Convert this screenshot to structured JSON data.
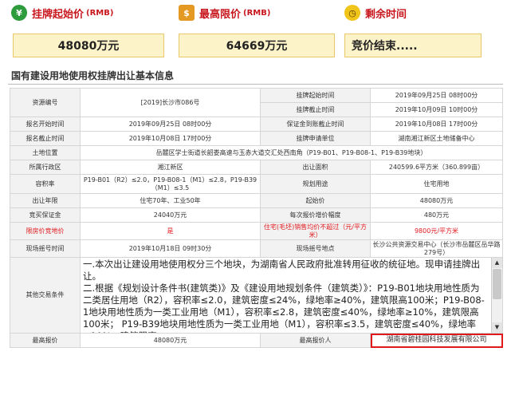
{
  "header": {
    "start_price_label": "挂牌起始价",
    "max_price_label": "最高限价",
    "remaining_label": "剩余时间",
    "unit_rmb": "(RMB)",
    "start_price_value": "48080万元",
    "max_price_value": "64669万元",
    "remaining_value": "竞价结束....."
  },
  "section_title": "国有建设用地使用权挂牌出让基本信息",
  "table": {
    "resource_no_label": "资源编号",
    "resource_no_value": "[2019]长沙市086号",
    "listing_start_time_label": "挂牌起始时间",
    "listing_start_time_value": "2019年09月25日 08时00分",
    "listing_end_time_label": "挂牌截止时间",
    "listing_end_time_value": "2019年10月09日 10时00分",
    "reg_start_label": "报名开始时间",
    "reg_start_value": "2019年09月25日 08时00分",
    "deposit_deadline_label": "保证金到账截止时间",
    "deposit_deadline_value": "2019年10月08日 17时00分",
    "reg_end_label": "报名截止时间",
    "reg_end_value": "2019年10月08日 17时00分",
    "applicant_label": "挂牌申请单位",
    "applicant_value": "湖南湘江新区土地储备中心",
    "location_label": "土地位置",
    "location_value": "岳麓区学士街道长韶娄高速与玉赤大道交汇处西南角（P19-B01、P19-B08-1、P19-B39地块）",
    "district_label": "所属行政区",
    "district_value": "湘江新区",
    "area_label": "出让面积",
    "area_value": "240599.6平方米（360.899亩）",
    "far_label": "容积率",
    "far_value": "P19-B01（R2）≤2.0，P19-B08-1（M1）≤2.8，P19-B39（M1）≤3.5",
    "use_label": "规划用途",
    "use_value": "住宅用地",
    "term_label": "出让年限",
    "term_value": "住宅70年、工业50年",
    "start_price_label": "起始价",
    "start_price_value": "48080万元",
    "bond_label": "竞买保证金",
    "bond_value": "24040万元",
    "increment_label": "每次报价增价幅度",
    "increment_value": "480万元",
    "limited_label": "限房价竞地价",
    "limited_value": "是",
    "house_price_label": "住宅(毛坯)销售均价不超过（元/平方米）",
    "house_price_value": "9800元/平方米",
    "draw_time_label": "现场摇号时间",
    "draw_time_value": "2019年10月18日 09时30分",
    "draw_place_label": "现场摇号地点",
    "draw_place_value": "长沙公共资源交易中心（长沙市岳麓区岳华路279号）",
    "other_label": "其他交易条件",
    "other_value": "一.本次出让建设用地使用权分三个地块，为湖南省人民政府批准转用征收的统征地。现申请挂牌出让。\n二.根据《规划设计条件书(建筑类)》及《建设用地规划条件（建筑类）》：P19-B01地块用地性质为二类居住用地（R2），容积率≤2.0，建筑密度≤24%，绿地率≥40%，建筑限高100米；P19-B08-1地块用地性质为一类工业用地（M1），容积率≤2.8，建筑密度≤40%，绿地率≥10%，建筑限高100米； P19-B39地块用地性质为一类工业用地（M1），容积率≤3.5，建筑密度≤40%，绿地率≥10%，建筑限高",
    "highest_bid_label": "最高报价",
    "highest_bid_value": "48080万元",
    "highest_bidder_label": "最高报价人",
    "highest_bidder_value": "湖南省碧桂园科技发展有限公司"
  },
  "colors": {
    "accent_red": "#c8161d",
    "price_box_bg": "#fdf3c8",
    "label_bg": "#f2f2f2"
  }
}
